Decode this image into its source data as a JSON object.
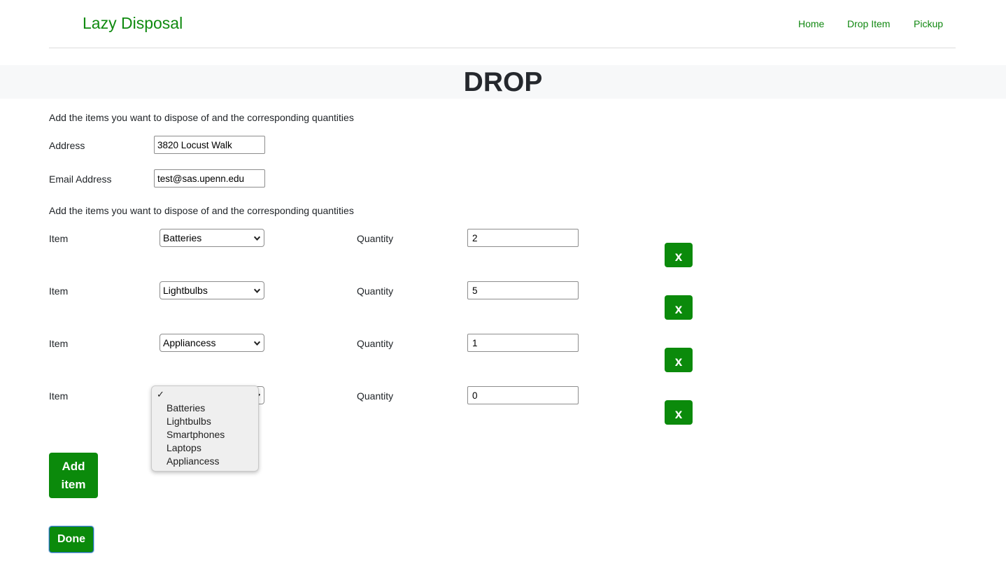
{
  "navbar": {
    "brand": "Lazy Disposal",
    "links": [
      "Home",
      "Drop Item",
      "Pickup"
    ]
  },
  "page": {
    "title": "DROP",
    "intro_top": "Add the items you want to dispose of and the corresponding quantities",
    "intro_items": "Add the items you want to dispose of and the corresponding quantities"
  },
  "form": {
    "address_label": "Address",
    "address_value": "3820 Locust Walk",
    "email_label": "Email Address",
    "email_value": "test@sas.upenn.edu"
  },
  "items": [
    {
      "item_label": "Item",
      "selected": "Batteries",
      "qty_label": "Quantity",
      "quantity": "2",
      "remove_label": "x"
    },
    {
      "item_label": "Item",
      "selected": "Lightbulbs",
      "qty_label": "Quantity",
      "quantity": "5",
      "remove_label": "x"
    },
    {
      "item_label": "Item",
      "selected": "Appliancess",
      "qty_label": "Quantity",
      "quantity": "1",
      "remove_label": "x"
    },
    {
      "item_label": "Item",
      "selected": "",
      "qty_label": "Quantity",
      "quantity": "0",
      "remove_label": "x"
    }
  ],
  "dropdown": {
    "check_glyph": "✓",
    "options": [
      "Batteries",
      "Lightbulbs",
      "Smartphones",
      "Laptops",
      "Appliancess"
    ]
  },
  "actions": {
    "add_item_label": "Add item",
    "done_label": "Done"
  },
  "colors": {
    "brand_green": "#0f8a0f",
    "button_green": "#0b8a0b",
    "header_band": "#f7f8f9",
    "focus_ring": "#1e6fb6"
  },
  "icons": {
    "select_arrow": "chevron-down-icon",
    "dropdown_check": "checkmark-icon"
  }
}
